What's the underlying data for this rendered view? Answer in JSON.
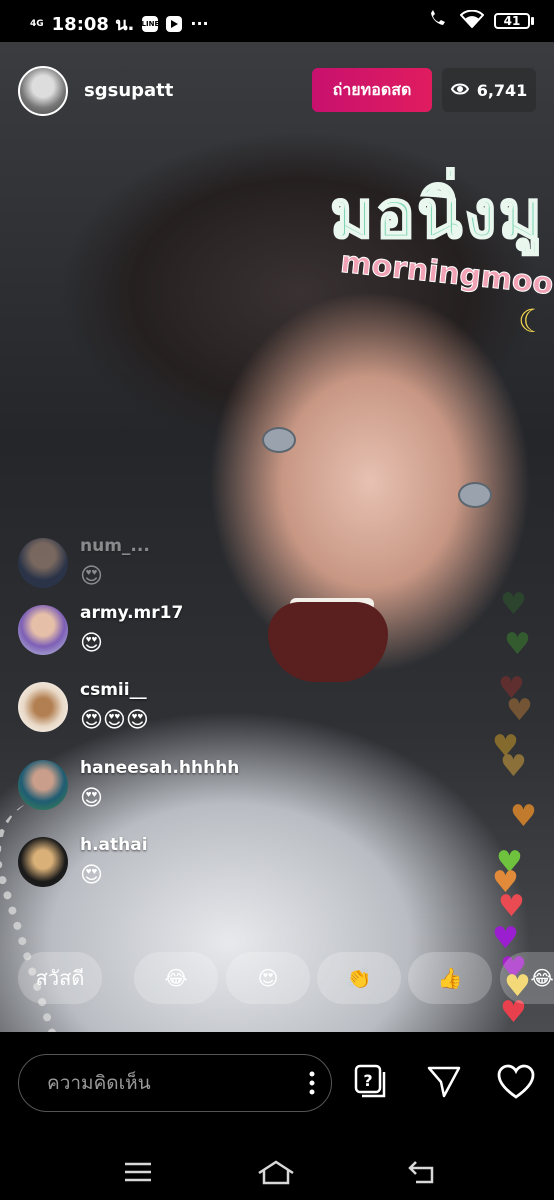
{
  "status_bar": {
    "network": "4G",
    "time": "18:08 น.",
    "app_icons": [
      "LINE",
      "YouTube"
    ],
    "more": "···",
    "battery": "41"
  },
  "live": {
    "username": "sgsupatt",
    "live_label": "ถ่ายทอดสด",
    "viewer_count": "6,741"
  },
  "sticker": {
    "thai_text": "มอนิ่งมู",
    "english_text": "morningmoon"
  },
  "comments": [
    {
      "user": "num_...",
      "message": "😍",
      "faded": true
    },
    {
      "user": "army.mr17",
      "message": "😍"
    },
    {
      "user": "csmii__",
      "message": "😍😍😍"
    },
    {
      "user": "haneesah.hhhhh",
      "message": "😍"
    },
    {
      "user": "h.athai",
      "message": "😍"
    }
  ],
  "quick_reactions": [
    "สวัสดี",
    "😂",
    "😍",
    "👏",
    "👍",
    "😂"
  ],
  "composer": {
    "placeholder": "ความคิดเห็น"
  },
  "colors": {
    "live_badge": "#d8176a",
    "background": "#000000"
  }
}
